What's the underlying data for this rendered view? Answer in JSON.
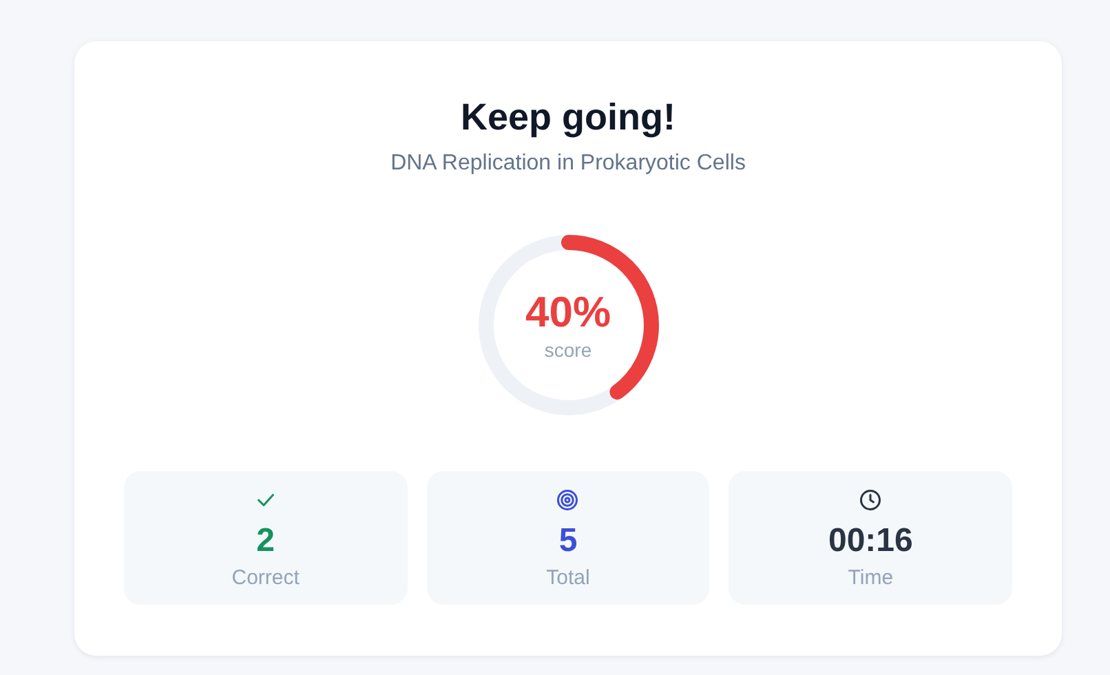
{
  "result": {
    "title": "Keep going!",
    "subtitle": "DNA Replication in Prokaryotic Cells"
  },
  "score": {
    "value": "40%",
    "label": "score"
  },
  "stats": [
    {
      "kind": "check",
      "value": "2",
      "label": "Correct",
      "color": "#15935f"
    },
    {
      "kind": "target",
      "value": "5",
      "label": "Total",
      "color": "#3b4fd8"
    },
    {
      "kind": "clock",
      "value": "00:16",
      "label": "Time",
      "color": "#2b3444"
    }
  ]
}
